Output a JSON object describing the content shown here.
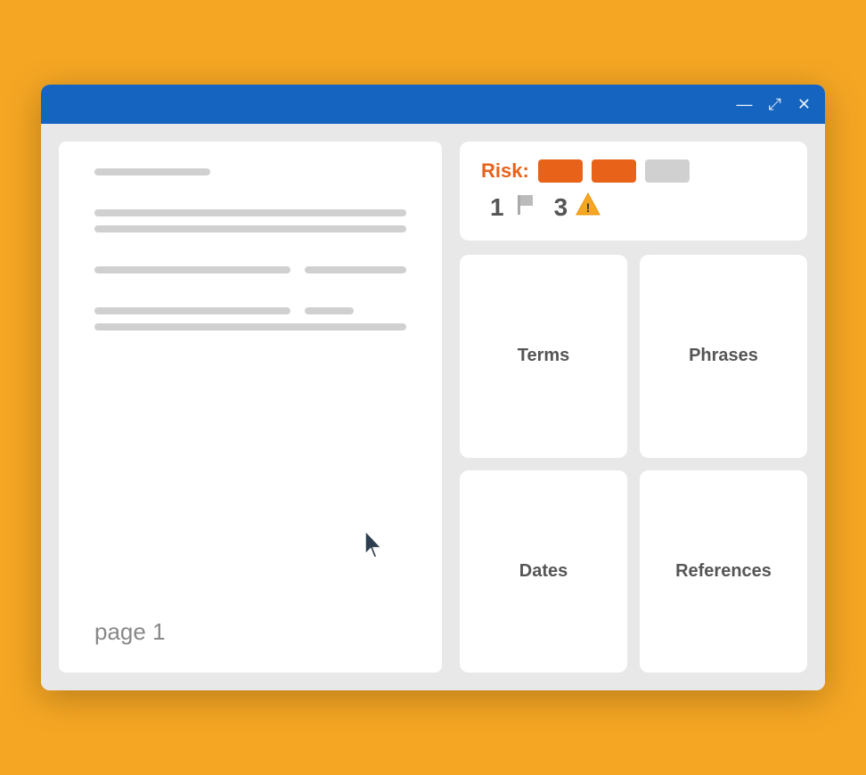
{
  "window": {
    "background_color": "#F5A623",
    "titlebar_color": "#1565C0"
  },
  "titlebar": {
    "minimize_label": "—",
    "maximize_label": "⤢",
    "close_label": "✕"
  },
  "risk": {
    "label": "Risk:",
    "bars": [
      "high",
      "medium",
      "low"
    ],
    "flag_count": "1",
    "warning_count": "3"
  },
  "grid": {
    "items": [
      {
        "id": "terms",
        "label": "Terms"
      },
      {
        "id": "phrases",
        "label": "Phrases"
      },
      {
        "id": "dates",
        "label": "Dates"
      },
      {
        "id": "references",
        "label": "References"
      }
    ]
  },
  "document": {
    "page_label": "page 1"
  }
}
